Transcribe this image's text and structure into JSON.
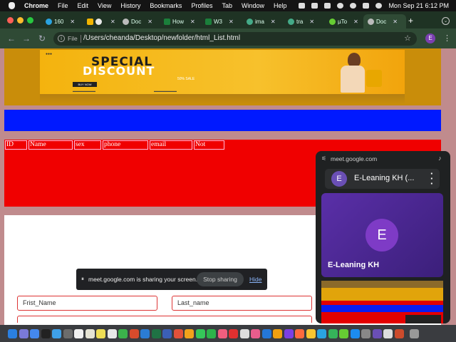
{
  "menubar": {
    "app": "Chrome",
    "items": [
      "File",
      "Edit",
      "View",
      "History",
      "Bookmarks",
      "Profiles",
      "Tab",
      "Window",
      "Help"
    ],
    "clock": "Mon Sep 21  6:12 PM"
  },
  "tabs": [
    {
      "label": "160"
    },
    {
      "label": ""
    },
    {
      "label": "Doc"
    },
    {
      "label": "How"
    },
    {
      "label": "W3"
    },
    {
      "label": "ima"
    },
    {
      "label": "tra"
    },
    {
      "label": "µTo"
    },
    {
      "label": "Doc"
    }
  ],
  "address": {
    "scheme": "File",
    "url": "/Users/cheanda/Desktop/newfolder/html_List.html"
  },
  "profile_initial": "E",
  "banner": {
    "title1": "SPECIAL",
    "title2": "DISCOUNT",
    "sub": "50% SALE",
    "button": "BUY NOW"
  },
  "table": {
    "headers": [
      "ID",
      "Name",
      "sex",
      "phone",
      "email",
      "Not"
    ]
  },
  "form": {
    "first_name_placeholder": "Frist_Name",
    "last_name_placeholder": "Last_name"
  },
  "share_bar": {
    "message": "meet.google.com is sharing your screen.",
    "stop": "Stop sharing",
    "hide": "Hide"
  },
  "pip": {
    "site": "meet.google.com",
    "meeting_title": "E-Leaning KH (...",
    "participant_initial": "E",
    "participant_name": "E-Leaning KH"
  },
  "colors": {
    "blue_band": "#0019ff",
    "red_band": "#f00000",
    "page_bg": "#c08b8d",
    "accent_purple": "#6a4fb5"
  }
}
